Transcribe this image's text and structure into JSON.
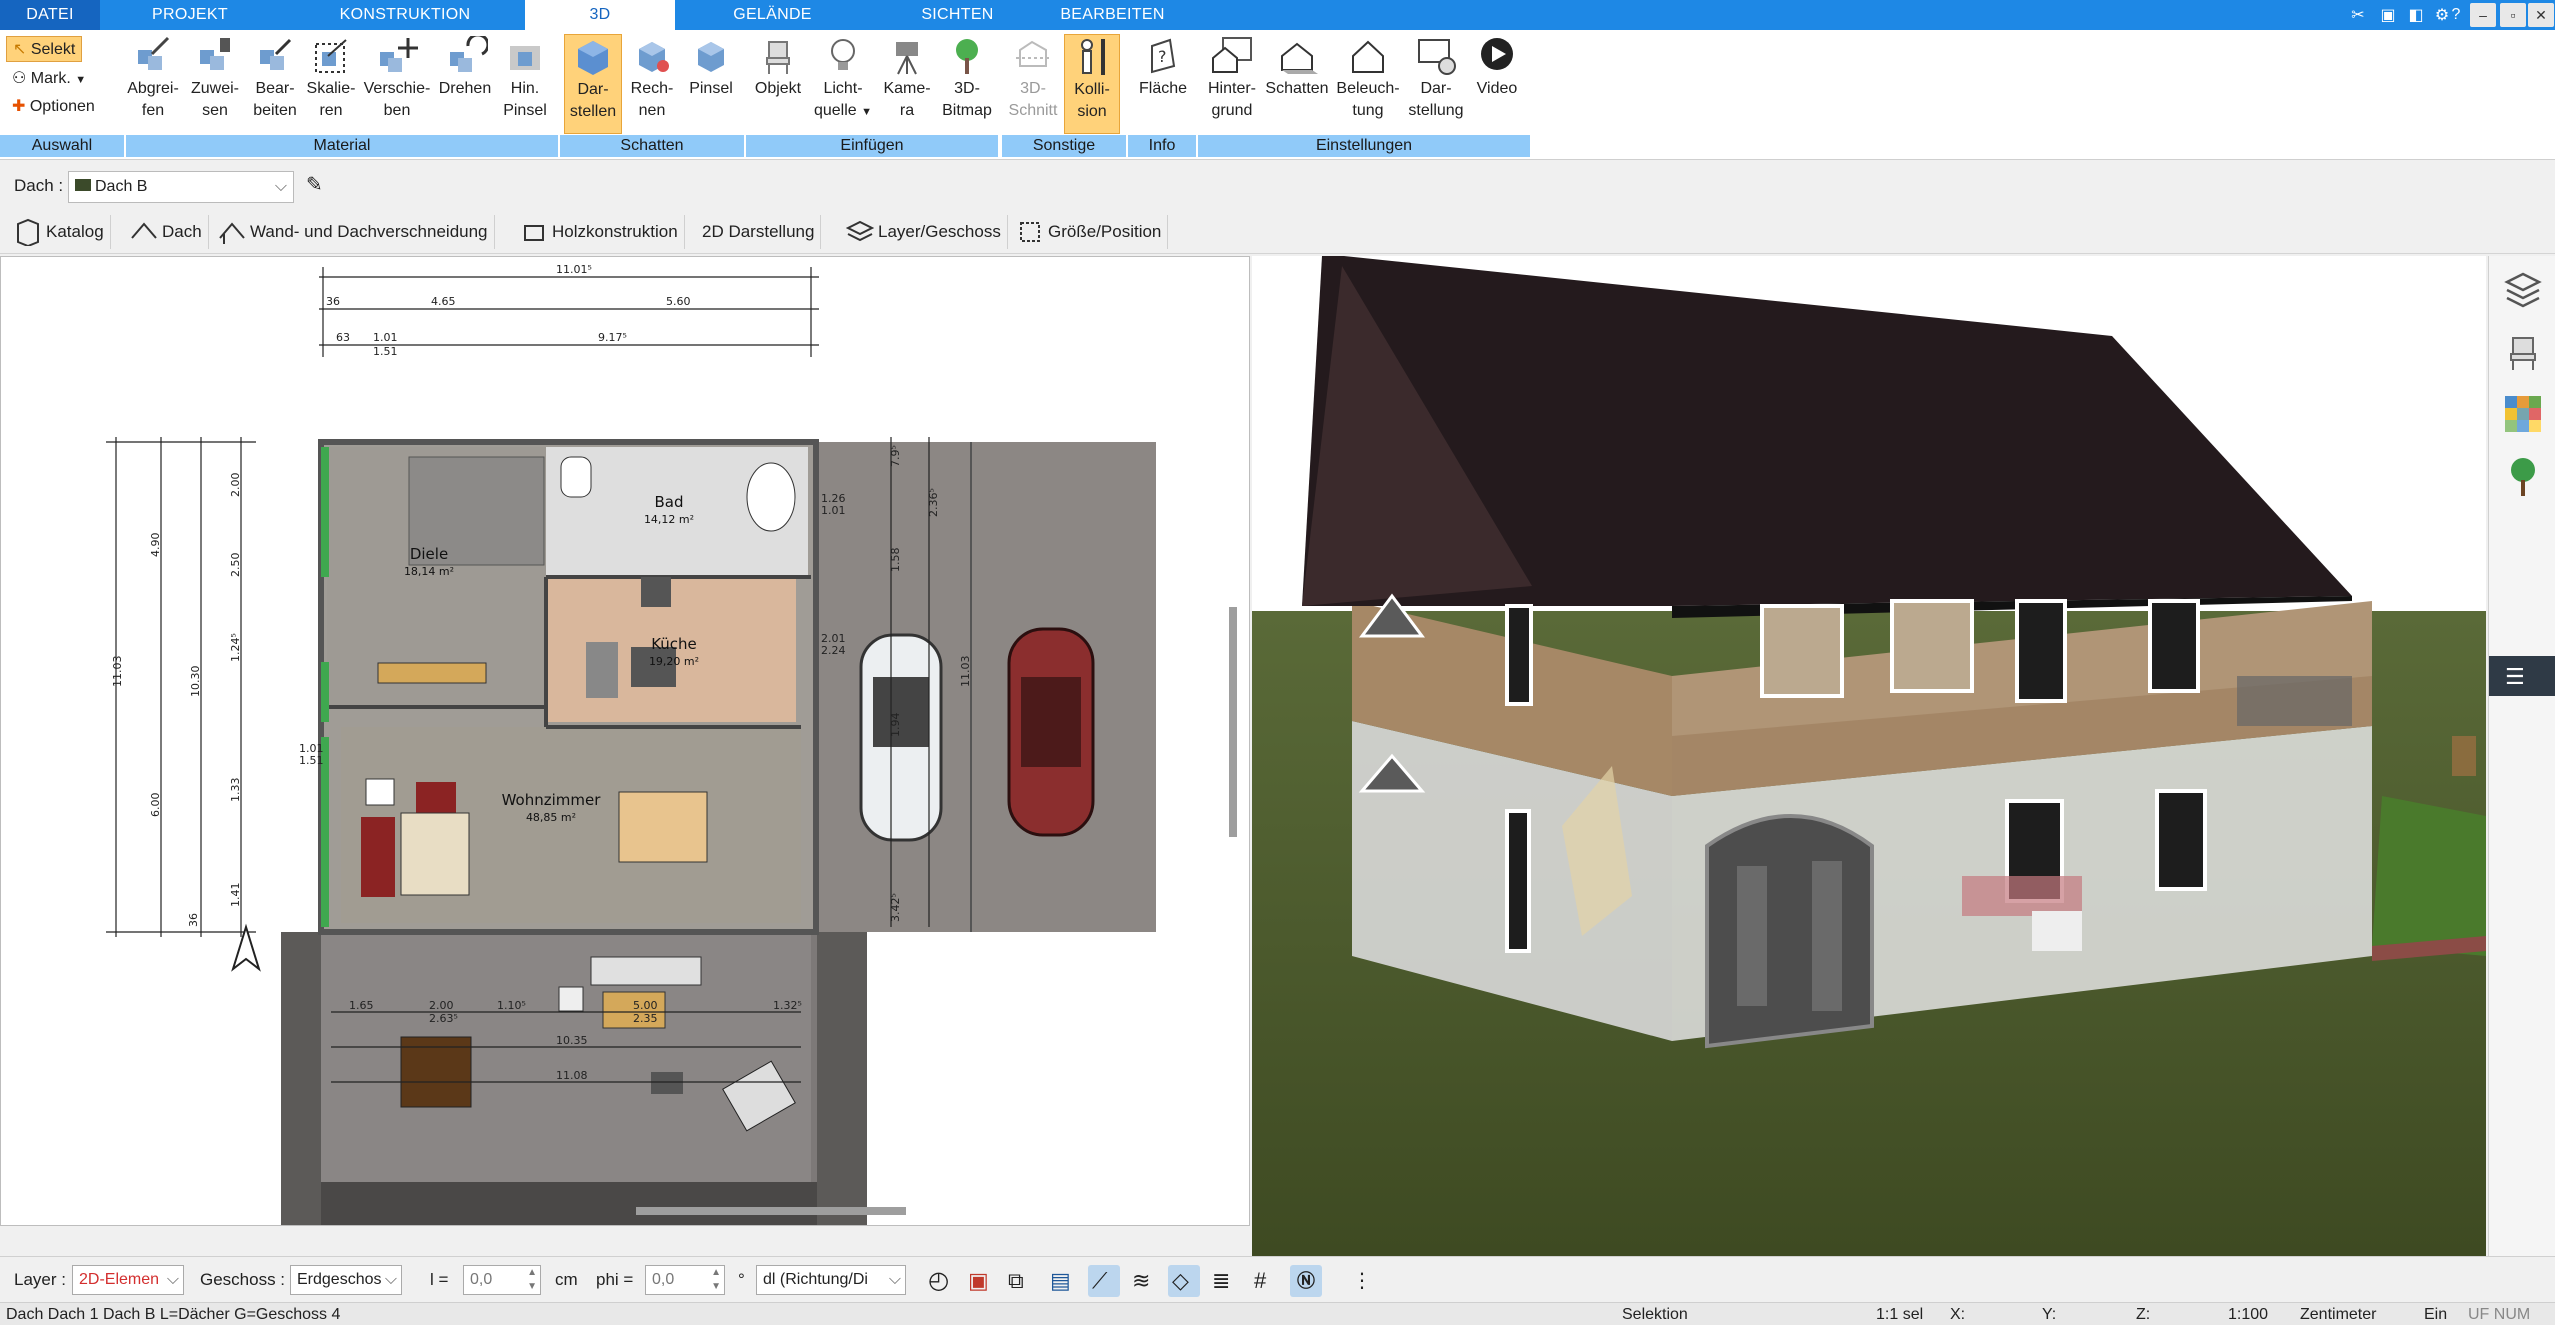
{
  "tabs": [
    "DATEI",
    "PROJEKT",
    "KONSTRUKTION",
    "3D",
    "GELÄNDE",
    "SICHTEN",
    "BEARBEITEN"
  ],
  "selection": {
    "select": "Selekt",
    "mark": "Mark.",
    "options": "Optionen",
    "group": "Auswahl"
  },
  "groups": {
    "material": "Material",
    "schatten": "Schatten",
    "einfuegen": "Einfügen",
    "sonstige": "Sonstige",
    "info": "Info",
    "einstellungen": "Einstellungen"
  },
  "ribbon": {
    "abgreifen": [
      "Abgrei-",
      "fen"
    ],
    "zuweisen": [
      "Zuwei-",
      "sen"
    ],
    "bearbeiten": [
      "Bear-",
      "beiten"
    ],
    "skalieren": [
      "Skalie-",
      "ren"
    ],
    "verschieben": [
      "Verschie-",
      "ben"
    ],
    "drehen": [
      "Drehen",
      ""
    ],
    "hinpinsel": [
      "Hin.",
      "Pinsel"
    ],
    "darstellen": [
      "Dar-",
      "stellen"
    ],
    "rechnen": [
      "Rech-",
      "nen"
    ],
    "pinsel": [
      "Pinsel",
      ""
    ],
    "objekt": [
      "Objekt",
      ""
    ],
    "lichtquelle": [
      "Licht-",
      "quelle"
    ],
    "kamera": [
      "Kame-",
      "ra"
    ],
    "bitmap3d": [
      "3D-",
      "Bitmap"
    ],
    "schnitt3d": [
      "3D-",
      "Schnitt"
    ],
    "kollision": [
      "Kolli-",
      "sion"
    ],
    "flaeche": [
      "Fläche",
      ""
    ],
    "hintergrund": [
      "Hinter-",
      "grund"
    ],
    "schatten": [
      "Schatten",
      ""
    ],
    "beleuchtung": [
      "Beleuch-",
      "tung"
    ],
    "darstellung": [
      "Dar-",
      "stellung"
    ],
    "video": [
      "Video",
      ""
    ]
  },
  "roof": {
    "label": "Dach :",
    "value": "Dach B"
  },
  "toolbar": {
    "katalog": "Katalog",
    "dach": "Dach",
    "wand": "Wand- und Dachverschneidung",
    "holz": "Holzkonstruktion",
    "darst2d": "2D Darstellung",
    "layer": "Layer/Geschoss",
    "groesse": "Größe/Position"
  },
  "plan": {
    "rooms": [
      {
        "name": "Bad",
        "area": "14,12 m²"
      },
      {
        "name": "Diele",
        "area": "18,14 m²"
      },
      {
        "name": "Küche",
        "area": "19,20 m²"
      },
      {
        "name": "Wohnzimmer",
        "area": "48,85 m²"
      }
    ],
    "dims_top": [
      "11.01⁵",
      "4.65",
      "5.60",
      "36",
      "9.17⁵",
      "1.01",
      "1.51",
      "63"
    ],
    "dims_left": [
      "11.03",
      "4.90",
      "10.30",
      "6.00",
      "2.00",
      "2.50",
      "1.24⁵",
      "1.01",
      "1.51",
      "1.33",
      "1.41",
      "36"
    ],
    "dims_terrace": [
      "1.65",
      "2.00",
      "2.63⁵",
      "1.10⁵",
      "5.00",
      "2.35",
      "1.32⁵",
      "10.35",
      "11.08"
    ],
    "dims_right": [
      "11.03",
      "2.01",
      "2.24",
      "1.94",
      "1.58",
      "1.26",
      "1.01",
      "3.42⁵",
      "7.9⁵",
      "2.36⁵"
    ]
  },
  "bottom": {
    "layer_label": "Layer :",
    "layer_value": "2D-Elemen",
    "geschoss_label": "Geschoss :",
    "geschoss_value": "Erdgeschos",
    "l_label": "l =",
    "l_value": "0,0",
    "l_unit": "cm",
    "phi_label": "phi =",
    "phi_value": "0,0",
    "phi_unit": "°",
    "dl_value": "dl (Richtung/Di"
  },
  "status": {
    "left": "Dach Dach 1 Dach B L=Dächer G=Geschoss 4",
    "mode": "Selektion",
    "sel": "1:1 sel",
    "x": "X:",
    "y": "Y:",
    "z": "Z:",
    "scale": "1:100",
    "unit": "Zentimeter",
    "ein": "Ein",
    "uf": "UF NUM RF"
  },
  "colors": {
    "ribbon_blue": "#1e88e5",
    "group_blue": "#90caf9",
    "selected": "#ffd27a",
    "roof": "#1f1417",
    "grass": "#4b5a2c",
    "sky": "#ffffff"
  }
}
